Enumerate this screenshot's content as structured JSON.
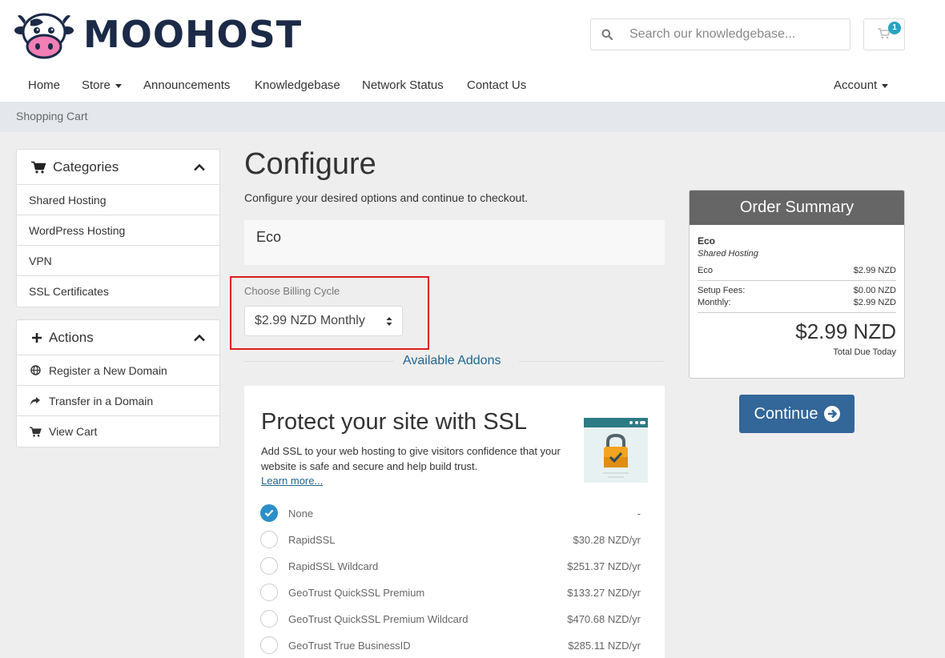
{
  "brand": {
    "name": "MOOHOST"
  },
  "search": {
    "placeholder": "Search our knowledgebase..."
  },
  "cart": {
    "count": "1"
  },
  "nav": {
    "home": "Home",
    "store": "Store",
    "announcements": "Announcements",
    "knowledgebase": "Knowledgebase",
    "network_status": "Network Status",
    "contact_us": "Contact Us",
    "account": "Account"
  },
  "breadcrumb": "Shopping Cart",
  "sidebar": {
    "categories": {
      "title": "Categories",
      "items": [
        "Shared Hosting",
        "WordPress Hosting",
        "VPN",
        "SSL Certificates"
      ]
    },
    "actions": {
      "title": "Actions",
      "items": [
        "Register a New Domain",
        "Transfer in a Domain",
        "View Cart"
      ]
    }
  },
  "main": {
    "title": "Configure",
    "subtitle": "Configure your desired options and continue to checkout.",
    "product_name": "Eco",
    "billing_label": "Choose Billing Cycle",
    "billing_value": "$2.99 NZD Monthly",
    "addons_label": "Available Addons"
  },
  "ssl": {
    "title": "Protect your site with SSL",
    "description": "Add SSL to your web hosting to give visitors confidence that your website is safe and secure and help build trust.",
    "learn_more": "Learn more...",
    "options": [
      {
        "label": "None",
        "price": "-",
        "checked": true
      },
      {
        "label": "RapidSSL",
        "price": "$30.28 NZD/yr",
        "checked": false
      },
      {
        "label": "RapidSSL Wildcard",
        "price": "$251.37 NZD/yr",
        "checked": false
      },
      {
        "label": "GeoTrust QuickSSL Premium",
        "price": "$133.27 NZD/yr",
        "checked": false
      },
      {
        "label": "GeoTrust QuickSSL Premium Wildcard",
        "price": "$470.68 NZD/yr",
        "checked": false
      },
      {
        "label": "GeoTrust True BusinessID",
        "price": "$285.11 NZD/yr",
        "checked": false
      }
    ]
  },
  "summary": {
    "title": "Order Summary",
    "product": "Eco",
    "group": "Shared Hosting",
    "line_label": "Eco",
    "line_price": "$2.99 NZD",
    "setup_label": "Setup Fees:",
    "setup_price": "$0.00 NZD",
    "monthly_label": "Monthly:",
    "monthly_price": "$2.99 NZD",
    "total": "$2.99 NZD",
    "total_label": "Total Due Today"
  },
  "continue_label": "Continue",
  "colors": {
    "brand": "#1b2a47",
    "primary_button": "#336699",
    "link": "#1f6690",
    "radio_checked": "#2a8ec8",
    "highlight_box": "#e01b1b",
    "badge": "#29a3c2"
  }
}
